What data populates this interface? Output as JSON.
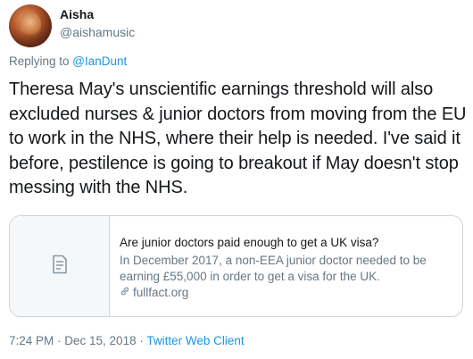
{
  "author": {
    "name": "Aisha",
    "handle": "@aishamusic"
  },
  "reply": {
    "prefix": "Replying to ",
    "target": "@IanDunt"
  },
  "tweet": {
    "text": "Theresa May's unscientific earnings threshold will also excluded nurses & junior doctors from moving from the EU to work in the NHS, where their help is needed. I've said it before, pestilence is going to breakout if May doesn't stop messing with the NHS."
  },
  "card": {
    "icon": "document-icon",
    "title": "Are junior doctors paid enough to get a UK visa?",
    "description": "In December 2017, a non-EEA junior doctor needed to be earning £55,000 in order to get a visa for the UK.",
    "link_icon": "link-icon",
    "domain": "fullfact.org"
  },
  "meta": {
    "timestamp": "7:24 PM · Dec 15, 2018 · ",
    "source": "Twitter Web Client"
  },
  "colors": {
    "link": "#1b95e0",
    "secondary_text": "#657786",
    "border": "#ccd6dd"
  }
}
